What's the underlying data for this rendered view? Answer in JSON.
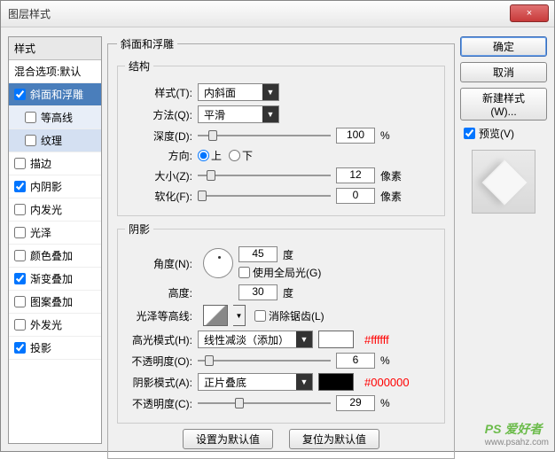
{
  "window": {
    "title": "图层样式",
    "close": "×"
  },
  "sidebar": {
    "header": "样式",
    "blendOptions": "混合选项:默认",
    "items": [
      {
        "label": "斜面和浮雕",
        "checked": true,
        "selected": true
      },
      {
        "label": "等高线",
        "checked": false,
        "sub": true
      },
      {
        "label": "纹理",
        "checked": false,
        "sub": true,
        "subselected": true
      },
      {
        "label": "描边",
        "checked": false
      },
      {
        "label": "内阴影",
        "checked": true
      },
      {
        "label": "内发光",
        "checked": false
      },
      {
        "label": "光泽",
        "checked": false
      },
      {
        "label": "颜色叠加",
        "checked": false
      },
      {
        "label": "渐变叠加",
        "checked": true
      },
      {
        "label": "图案叠加",
        "checked": false
      },
      {
        "label": "外发光",
        "checked": false
      },
      {
        "label": "投影",
        "checked": true
      }
    ]
  },
  "main": {
    "groupTitle": "斜面和浮雕",
    "structure": {
      "title": "结构",
      "styleLabel": "样式(T):",
      "styleValue": "内斜面",
      "techLabel": "方法(Q):",
      "techValue": "平滑",
      "depthLabel": "深度(D):",
      "depthValue": "100",
      "depthUnit": "%",
      "dirLabel": "方向:",
      "dirUp": "上",
      "dirDown": "下",
      "sizeLabel": "大小(Z):",
      "sizeValue": "12",
      "sizeUnit": "像素",
      "softenLabel": "软化(F):",
      "softenValue": "0",
      "softenUnit": "像素"
    },
    "shading": {
      "title": "阴影",
      "angleLabel": "角度(N):",
      "angleValue": "45",
      "angleUnit": "度",
      "useGlobal": "使用全局光(G)",
      "altLabel": "高度:",
      "altValue": "30",
      "altUnit": "度",
      "glossLabel": "光泽等高线:",
      "antiAlias": "消除锯齿(L)",
      "hlModeLabel": "高光模式(H):",
      "hlModeValue": "线性减淡（添加）",
      "hlColor": "#ffffff",
      "hlAnnot": "#ffffff",
      "hlOpacLabel": "不透明度(O):",
      "hlOpacValue": "6",
      "hlOpacUnit": "%",
      "shModeLabel": "阴影模式(A):",
      "shModeValue": "正片叠底",
      "shColor": "#000000",
      "shAnnot": "#000000",
      "shOpacLabel": "不透明度(C):",
      "shOpacValue": "29",
      "shOpacUnit": "%"
    },
    "buttons": {
      "default": "设置为默认值",
      "reset": "复位为默认值"
    }
  },
  "right": {
    "ok": "确定",
    "cancel": "取消",
    "newStyle": "新建样式(W)...",
    "preview": "预览(V)"
  },
  "watermark": {
    "brand": "PS 爱好者",
    "url": "www.psahz.com"
  }
}
